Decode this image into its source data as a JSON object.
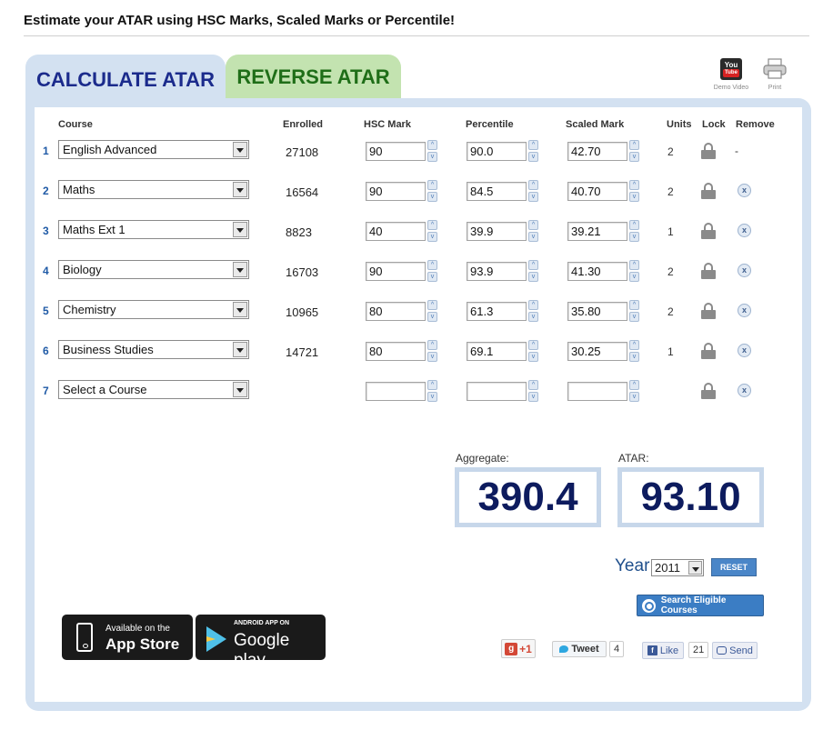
{
  "header": {
    "title": "Estimate your ATAR using HSC Marks, Scaled Marks or Percentile!"
  },
  "tabs": {
    "calculate": "CALCULATE ATAR",
    "reverse": "REVERSE ATAR"
  },
  "tools": {
    "youtube_you": "You",
    "youtube_tube": "Tube",
    "demo_video": "Demo Video",
    "print": "Print"
  },
  "columns": {
    "course": "Course",
    "enrolled": "Enrolled",
    "hsc_mark": "HSC Mark",
    "percentile": "Percentile",
    "scaled_mark": "Scaled Mark",
    "units": "Units",
    "lock": "Lock",
    "remove": "Remove"
  },
  "rows": [
    {
      "num": "1",
      "course": "English Advanced",
      "enrolled": "27108",
      "hsc": "90",
      "percentile": "90.0",
      "scaled": "42.70",
      "units": "2",
      "remove": "-"
    },
    {
      "num": "2",
      "course": "Maths",
      "enrolled": "16564",
      "hsc": "90",
      "percentile": "84.5",
      "scaled": "40.70",
      "units": "2",
      "remove": "x"
    },
    {
      "num": "3",
      "course": "Maths Ext 1",
      "enrolled": "8823",
      "hsc": "40",
      "percentile": "39.9",
      "scaled": "39.21",
      "units": "1",
      "remove": "x"
    },
    {
      "num": "4",
      "course": "Biology",
      "enrolled": "16703",
      "hsc": "90",
      "percentile": "93.9",
      "scaled": "41.30",
      "units": "2",
      "remove": "x"
    },
    {
      "num": "5",
      "course": "Chemistry",
      "enrolled": "10965",
      "hsc": "80",
      "percentile": "61.3",
      "scaled": "35.80",
      "units": "2",
      "remove": "x"
    },
    {
      "num": "6",
      "course": "Business Studies",
      "enrolled": "14721",
      "hsc": "80",
      "percentile": "69.1",
      "scaled": "30.25",
      "units": "1",
      "remove": "x"
    },
    {
      "num": "7",
      "course": "Select a Course",
      "enrolled": "",
      "hsc": "",
      "percentile": "",
      "scaled": "",
      "units": "",
      "remove": "x"
    }
  ],
  "spinner": {
    "up": "^",
    "down": "v"
  },
  "results": {
    "aggregate_label": "Aggregate:",
    "aggregate_value": "390.4",
    "atar_label": "ATAR:",
    "atar_value": "93.10"
  },
  "controls": {
    "year_label": "Year",
    "year_value": "2011",
    "reset_label": "RESET",
    "search_label": "Search Eligible Courses"
  },
  "badges": {
    "apple_small": "Available on the",
    "apple_big": "App Store",
    "google_small": "ANDROID APP ON",
    "google_big": "Google play"
  },
  "social": {
    "gplus_g": "g",
    "gplus_label": "+1",
    "tweet_label": "Tweet",
    "tweet_count": "4",
    "fb_f": "f",
    "fb_like": "Like",
    "fb_count": "21",
    "fb_send": "Send"
  },
  "colors": {
    "panel": "#d3e1f1",
    "calc_tab_text": "#1b2b8c",
    "reverse_tab": "#c3e3b0",
    "reverse_tab_text": "#1f6e18",
    "result_text": "#0d1b5e",
    "button_blue": "#3b7dc4"
  }
}
